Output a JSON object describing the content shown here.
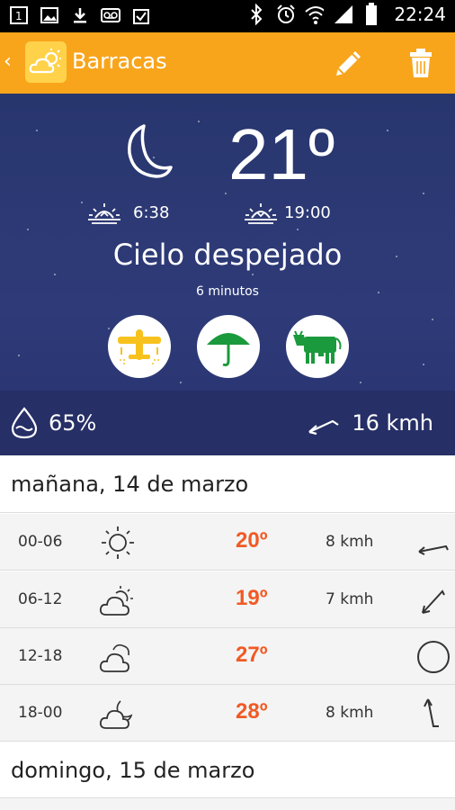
{
  "status_bar": {
    "time": "22:24",
    "left_icons": [
      "sim-1-icon",
      "image-icon",
      "download-icon",
      "voicemail-icon",
      "clipboard-check-icon"
    ],
    "right_icons": [
      "bluetooth-icon",
      "alarm-icon",
      "wifi-icon",
      "signal-icon",
      "battery-icon"
    ]
  },
  "app_bar": {
    "title": "Barracas",
    "back_glyph": "‹",
    "color": "#f8a51c"
  },
  "current": {
    "temperature": "21º",
    "sunrise": "6:38",
    "sunset": "19:00",
    "condition": "Cielo despejado",
    "updated": "6 minutos",
    "humidity": "65%",
    "wind": "16 kmh",
    "advice_icons": [
      "plane-icon",
      "umbrella-icon",
      "cow-icon"
    ]
  },
  "days": [
    {
      "label": "mañana, 14 de marzo",
      "rows": [
        {
          "period": "00-06",
          "icon": "sun-icon",
          "temp": "20º",
          "wind": "8 kmh",
          "dir": "arrow-down-left-icon"
        },
        {
          "period": "06-12",
          "icon": "cloud-sun-icon",
          "temp": "19º",
          "wind": "7 kmh",
          "dir": "arrow-down-left-icon"
        },
        {
          "period": "12-18",
          "icon": "cloud-icon",
          "temp": "27º",
          "wind": "",
          "dir": "calm-circle-icon"
        },
        {
          "period": "18-00",
          "icon": "cloud-moon-icon",
          "temp": "28º",
          "wind": "8 kmh",
          "dir": "arrow-up-icon"
        }
      ]
    },
    {
      "label": "domingo, 15 de marzo",
      "rows": []
    }
  ],
  "colors": {
    "accent": "#f8a51c",
    "temp_text": "#f15a24",
    "hero_bg": "#2f3b78"
  }
}
